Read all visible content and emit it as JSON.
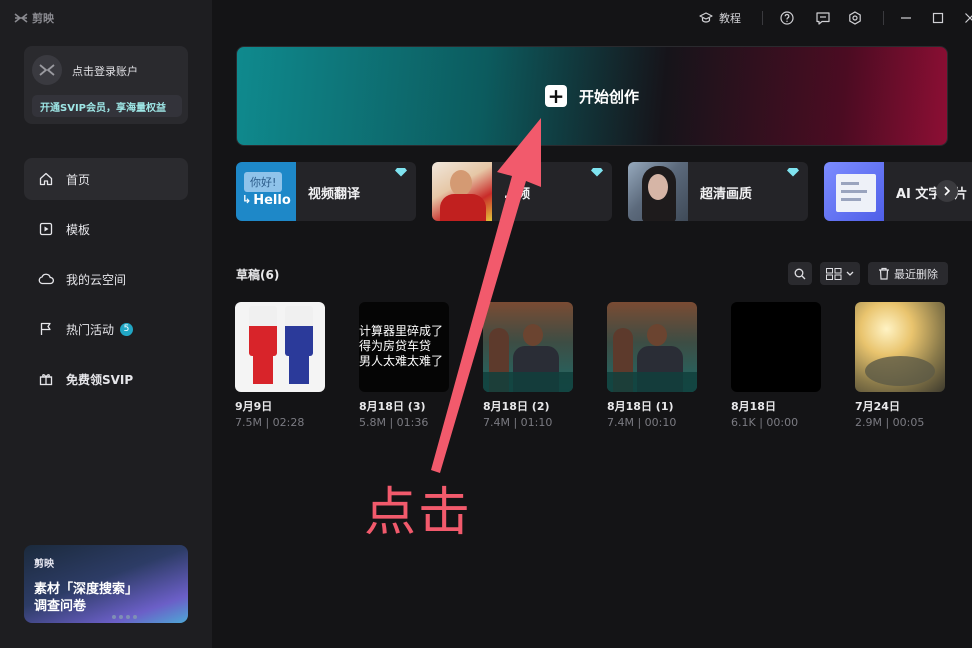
{
  "app": {
    "name": "剪映"
  },
  "titlebar": {
    "tutorial_label": "教程"
  },
  "sidebar": {
    "login_text": "点击登录账户",
    "svip_text": "开通SVIP会员，享海量权益",
    "nav": [
      {
        "label": "首页",
        "icon": "home-icon"
      },
      {
        "label": "模板",
        "icon": "template-icon"
      },
      {
        "label": "我的云空间",
        "icon": "cloud-icon"
      },
      {
        "label": "热门活动",
        "icon": "flag-icon",
        "badge": "5"
      },
      {
        "label": "免费领SVIP",
        "icon": "gift-icon"
      }
    ],
    "promo": {
      "logo_text": "剪映",
      "line1": "素材「深度搜索」",
      "line2": "调查问卷"
    }
  },
  "main": {
    "create_label": "开始创作",
    "tools": [
      {
        "label": "视频翻译",
        "thumb_text_1": "你好!",
        "thumb_text_2": "Hello"
      },
      {
        "label": "…频"
      },
      {
        "label": "超清画质"
      },
      {
        "label": "AI 文字成片"
      }
    ],
    "drafts_title": "草稿(6)",
    "recent_delete_label": "最近删除",
    "drafts": [
      {
        "name": "9月9日",
        "meta": "7.5M | 02:28"
      },
      {
        "name": "8月18日 (3)",
        "meta": "5.8M | 01:36",
        "caption": [
          "计算器里碎成了",
          "得为房贷车贷",
          "男人太难太难了"
        ]
      },
      {
        "name": "8月18日 (2)",
        "meta": "7.4M | 01:10"
      },
      {
        "name": "8月18日 (1)",
        "meta": "7.4M | 00:10"
      },
      {
        "name": "8月18日",
        "meta": "6.1K | 00:00"
      },
      {
        "name": "7月24日",
        "meta": "2.9M | 00:05"
      }
    ]
  },
  "annotation": {
    "text": "点击"
  },
  "colors": {
    "accent": "#21a6c4",
    "annotation": "#f25a6c",
    "gem": "#7fe3f0"
  }
}
